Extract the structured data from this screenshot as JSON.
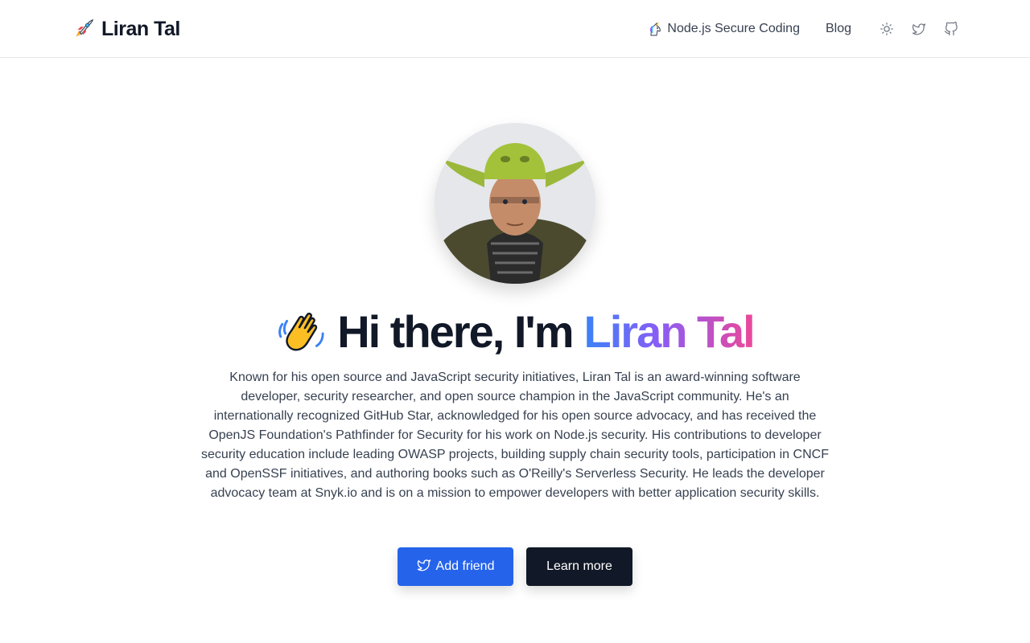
{
  "header": {
    "brand_icon": "rocket-icon",
    "brand_name": "Liran Tal",
    "nav": {
      "course_icon": "unicorn-icon",
      "course_label": "Node.js Secure Coding",
      "blog_label": "Blog"
    },
    "icons": [
      "sun-icon",
      "twitter-icon",
      "github-icon"
    ]
  },
  "hero": {
    "wave_icon": "waving-hand-icon",
    "greeting": "Hi there, I'm",
    "name": "Liran Tal",
    "bio": "Known for his open source and JavaScript security initiatives, Liran Tal is an award-winning software developer, security researcher, and open source champion in the JavaScript community. He's an internationally recognized GitHub Star, acknowledged for his open source advocacy, and has received the OpenJS Foundation's Pathfinder for Security for his work on Node.js security. His contributions to developer security education include leading OWASP projects, building supply chain security tools, participation in CNCF and OpenSSF initiatives, and authoring books such as O'Reilly's Serverless Security. He leads the developer advocacy team at Snyk.io and is on a mission to empower developers with better application security skills.",
    "primary_button": "Add friend",
    "secondary_button": "Learn more"
  },
  "colors": {
    "primary": "#2563eb",
    "dark": "#111827",
    "gradient_start": "#3b82f6",
    "gradient_mid": "#8b5cf6",
    "gradient_end": "#ec4899"
  }
}
